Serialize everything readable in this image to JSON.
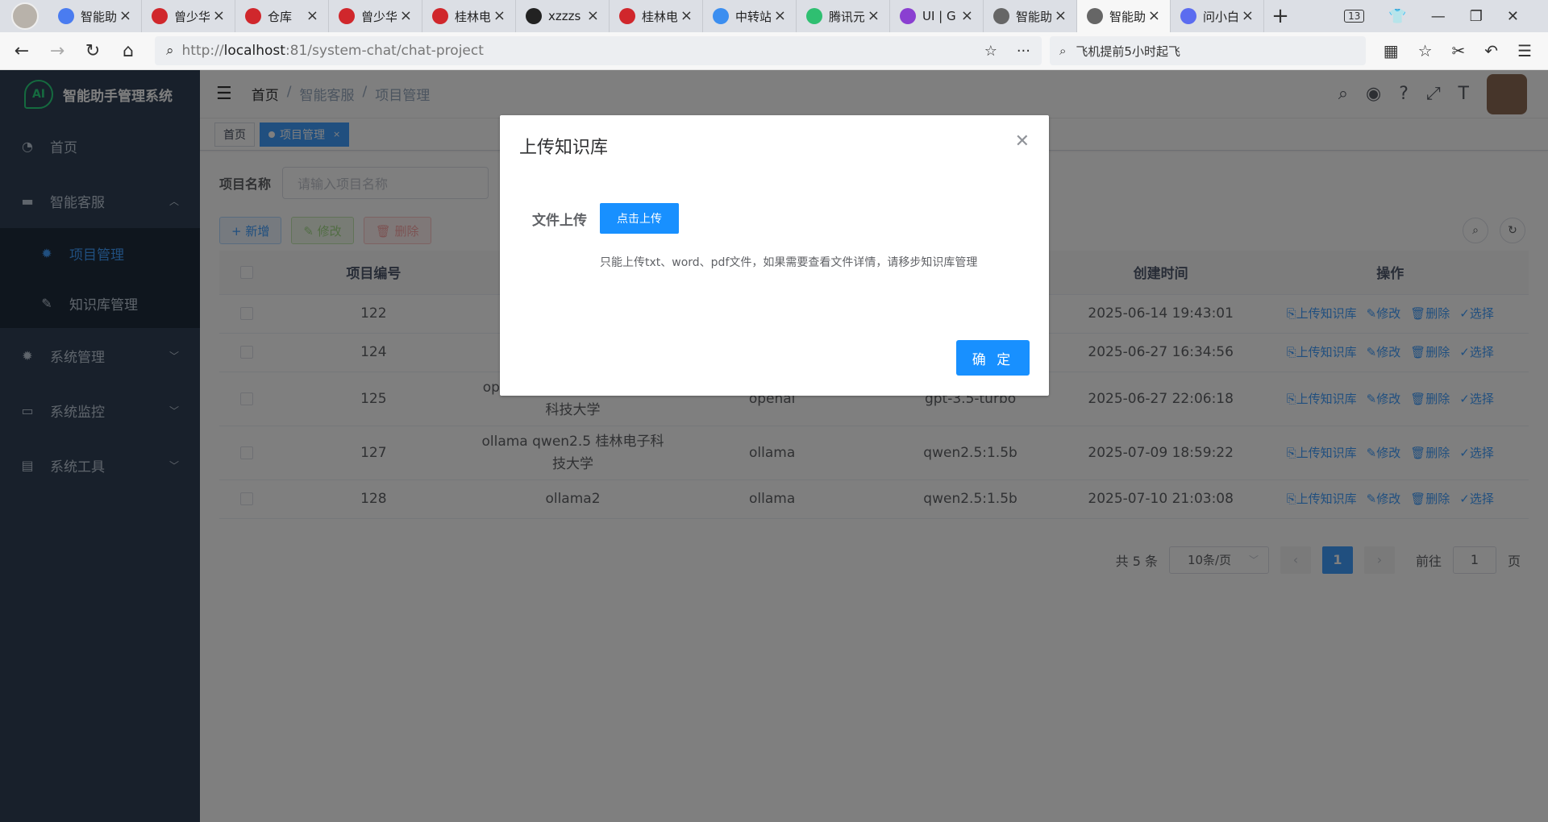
{
  "browser": {
    "tabs": [
      {
        "label": "智能助",
        "color": "#4a7cf0",
        "icon": "robot-icon"
      },
      {
        "label": "曾少华",
        "color": "#d0272c",
        "icon": "gitee-icon"
      },
      {
        "label": "仓库",
        "color": "#d0272c",
        "icon": "gitee-icon"
      },
      {
        "label": "曾少华",
        "color": "#d0272c",
        "icon": "gitee-icon"
      },
      {
        "label": "桂林电",
        "color": "#d0272c",
        "icon": "gitee-icon"
      },
      {
        "label": "xzzzs",
        "color": "#222222",
        "icon": "github-icon"
      },
      {
        "label": "桂林电",
        "color": "#d0272c",
        "icon": "gitee-icon"
      },
      {
        "label": "中转站",
        "color": "#3b8ef0",
        "icon": "chrome-icon"
      },
      {
        "label": "腾讯元",
        "color": "#2fbf71",
        "icon": "yuanbao-icon"
      },
      {
        "label": "UI | G",
        "color": "#8a3fd1",
        "icon": "shield-icon"
      },
      {
        "label": "智能助",
        "color": "#666666",
        "icon": "globe-icon"
      },
      {
        "label": "智能助",
        "color": "#666666",
        "icon": "globe-icon",
        "active": true
      },
      {
        "label": "问小白",
        "color": "#5b6cf0",
        "icon": "chat-icon"
      }
    ],
    "tab_count": "13",
    "url_host": "localhost",
    "url_prefix": "http://",
    "url_rest": ":81/system-chat/chat-project",
    "search_text": "飞机提前5小时起飞"
  },
  "app": {
    "logo_text": "智能助手管理系统",
    "logo_mark": "AI",
    "menu": {
      "home": "首页",
      "service": "智能客服",
      "project_mgmt": "项目管理",
      "kb_mgmt": "知识库管理",
      "system_mgmt": "系统管理",
      "system_monitor": "系统监控",
      "system_tools": "系统工具"
    },
    "breadcrumb": [
      "首页",
      "/",
      "智能客服",
      "/",
      "项目管理"
    ],
    "tags": {
      "home": "首页",
      "current": "项目管理",
      "close": "×"
    }
  },
  "query": {
    "label": "项目名称",
    "placeholder": "请输入项目名称"
  },
  "toolbar": {
    "add": "+ 新增",
    "edit": "✎ 修改",
    "del": "🗑 删除"
  },
  "table": {
    "headers": [
      "项目编号",
      "",
      "",
      "",
      "创建时间",
      "操作"
    ],
    "rows": [
      {
        "id": "122",
        "name": "",
        "type": "",
        "model": "",
        "time": "2025-06-14 19:43:01"
      },
      {
        "id": "124",
        "name": "",
        "type": "",
        "model": "",
        "time": "2025-06-27 16:34:56"
      },
      {
        "id": "125",
        "name": "openai qwen-plus 桂林电子\n科技大学",
        "type": "openai",
        "model": "gpt-3.5-turbo",
        "time": "2025-06-27 22:06:18"
      },
      {
        "id": "127",
        "name": "ollama qwen2.5 桂林电子科\n技大学",
        "type": "ollama",
        "model": "qwen2.5:1.5b",
        "time": "2025-07-09 18:59:22"
      },
      {
        "id": "128",
        "name": "ollama2",
        "type": "ollama",
        "model": "qwen2.5:1.5b",
        "time": "2025-07-10 21:03:08"
      }
    ],
    "ops": {
      "upload": "⎘上传知识库",
      "edit": "✎修改",
      "del": "🗑删除",
      "select": "✓选择"
    }
  },
  "pager": {
    "total": "共 5 条",
    "page_size": "10条/页",
    "current": "1",
    "goto": "前往",
    "goto_value": "1",
    "page_unit": "页"
  },
  "dialog": {
    "title": "上传知识库",
    "label": "文件上传",
    "upload_btn": "点击上传",
    "tip": "只能上传txt、word、pdf文件，如果需要查看文件详情，请移步知识库管理",
    "confirm": "确 定"
  }
}
